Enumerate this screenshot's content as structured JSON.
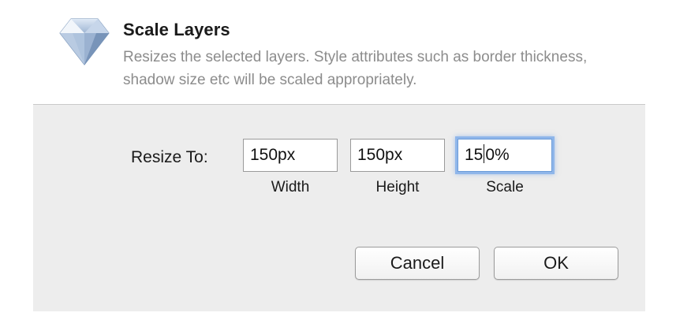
{
  "dialog": {
    "title": "Scale Layers",
    "description": "Resizes the selected layers. Style attributes such as border thickness, shadow size etc will be scaled appropriately.",
    "icon": "sketch-diamond-icon"
  },
  "form": {
    "resize_label": "Resize To:",
    "fields": [
      {
        "label": "Width",
        "value": "150px"
      },
      {
        "label": "Height",
        "value": "150px"
      },
      {
        "label": "Scale",
        "value_before_caret": "15",
        "value_after_caret": "0%",
        "value": "150%",
        "focused": true
      }
    ]
  },
  "buttons": {
    "cancel_label": "Cancel",
    "ok_label": "OK"
  },
  "colors": {
    "panel_background": "#ededed",
    "focus_ring": "#8fb6ea",
    "description_text": "#8c8c8c"
  }
}
